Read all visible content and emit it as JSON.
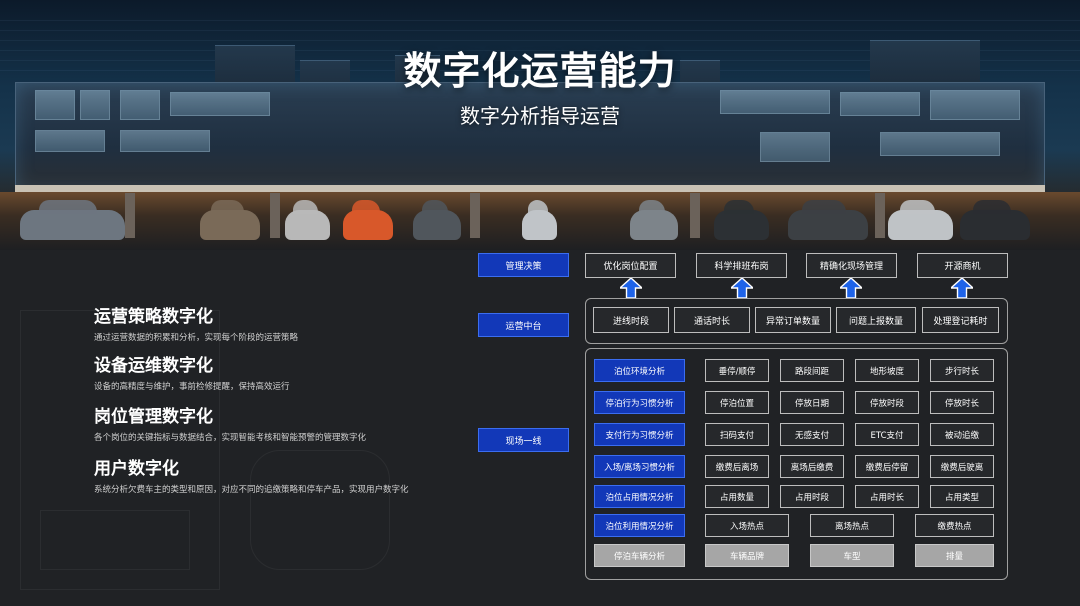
{
  "header": {
    "title": "数字化运营能力",
    "subtitle": "数字分析指导运营"
  },
  "left_sections": [
    {
      "heading": "运营策略数字化",
      "desc": "通过运营数据的积累和分析，实现每个阶段的运营策略"
    },
    {
      "heading": "设备运维数字化",
      "desc": "设备的高精度与维护，事前检修提醒，保持高效运行"
    },
    {
      "heading": "岗位管理数字化",
      "desc": "各个岗位的关键指标与数据结合，实现智能考核和智能预警的管理数字化"
    },
    {
      "heading": "用户数字化",
      "desc": "系统分析欠费车主的类型和原因，对应不同的追缴策略和停车产品，实现用户数字化"
    }
  ],
  "levels": {
    "decision": "管理决策",
    "middle": "运营中台",
    "field": "现场一线"
  },
  "decision_items": [
    "优化岗位配置",
    "科学排班布岗",
    "精确化现场管理",
    "开源商机"
  ],
  "middle_items": [
    "进线时段",
    "通话时长",
    "异常订单数量",
    "问题上报数量",
    "处理登记耗时"
  ],
  "field_rows": [
    {
      "label": "泊位环境分析",
      "items": [
        "垂停/顺停",
        "路段间距",
        "地形坡度",
        "步行时长"
      ]
    },
    {
      "label": "停泊行为习惯分析",
      "items": [
        "停泊位置",
        "停放日期",
        "停放时段",
        "停放时长"
      ]
    },
    {
      "label": "支付行为习惯分析",
      "items": [
        "扫码支付",
        "无感支付",
        "ETC支付",
        "被动追缴"
      ]
    },
    {
      "label": "入场/离场习惯分析",
      "items": [
        "缴费后离场",
        "离场后缴费",
        "缴费后停留",
        "缴费后驶离"
      ]
    },
    {
      "label": "泊位占用情况分析",
      "items": [
        "占用数量",
        "占用时段",
        "占用时长",
        "占用类型"
      ]
    },
    {
      "label": "泊位利用情况分析",
      "items": [
        "入场热点",
        "离场热点",
        "缴费热点"
      ]
    },
    {
      "label": "停泊车辆分析",
      "items": [
        "车辆品牌",
        "车型",
        "排量"
      ]
    }
  ],
  "colors": {
    "accent_blue": "#1238b8",
    "arrow_blue": "#1e63e8",
    "grey_cell": "#a6a6a6",
    "background": "#202225"
  }
}
